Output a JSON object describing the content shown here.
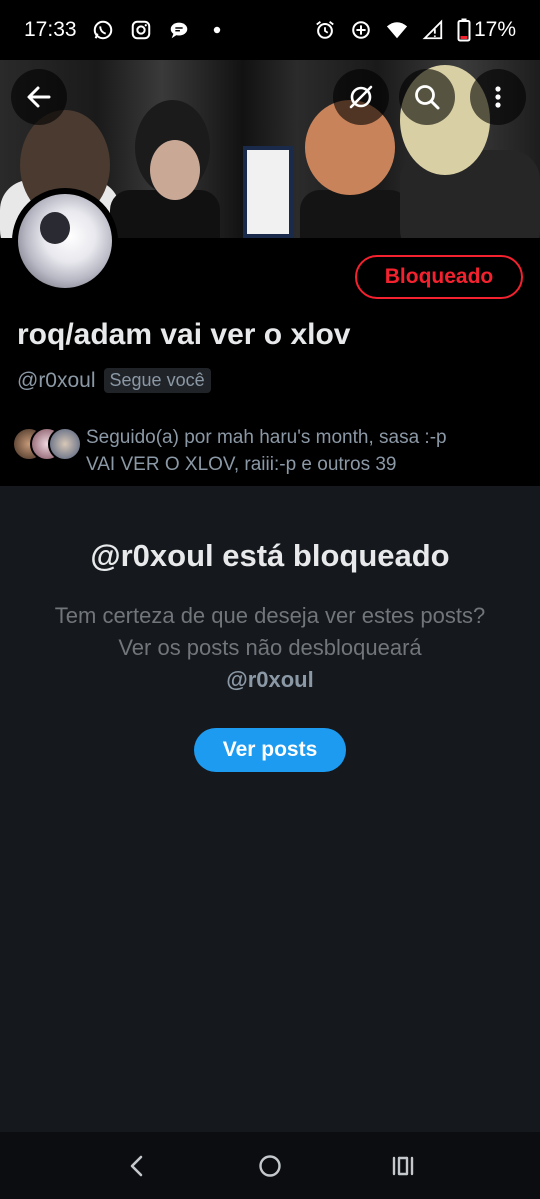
{
  "status_bar": {
    "time": "17:33",
    "battery": "17%",
    "left_icons": [
      "whatsapp-icon",
      "instagram-icon",
      "chat-bubble-icon",
      "dot-icon"
    ],
    "right_icons": [
      "alarm-icon",
      "data-saver-icon",
      "wifi-icon",
      "signal-icon",
      "battery-icon"
    ]
  },
  "header": {
    "buttons": [
      "back-arrow-icon",
      "grok-icon",
      "search-icon",
      "more-vertical-icon"
    ]
  },
  "profile": {
    "display_name": "roq/adam vai ver o xlov",
    "handle": "@r0xoul",
    "follows_you": "Segue você",
    "blocked_button": "Bloqueado",
    "followed_by_line1": "Seguido(a) por mah haru's month, sasa :-p",
    "followed_by_line2": "VAI VER O XLOV, raiii:-p e outros 39"
  },
  "blocked_notice": {
    "title": "@r0xoul está bloqueado",
    "description": "Tem certeza de que deseja ver estes posts? Ver os posts não desbloqueará",
    "handle": "@r0xoul",
    "button": "Ver posts"
  },
  "colors": {
    "accent": "#1d9bf0",
    "blocked_red": "#f4212e",
    "background": "#15181d",
    "header_background": "#000000",
    "secondary_text": "#71767b"
  },
  "nav": [
    "back-nav-icon",
    "home-nav-icon",
    "recents-nav-icon"
  ]
}
